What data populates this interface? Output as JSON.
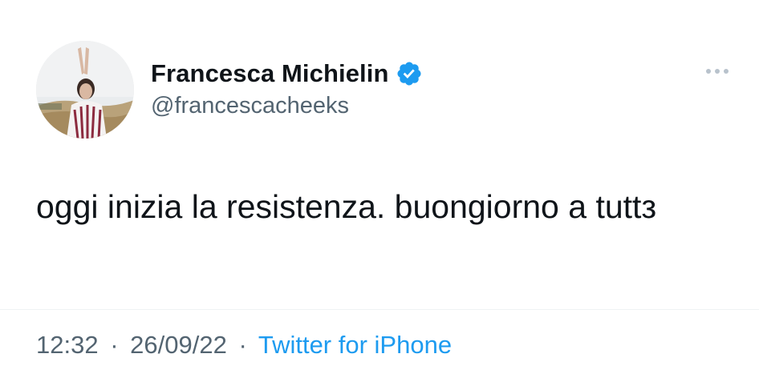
{
  "tweet": {
    "author": {
      "display_name": "Francesca Michielin",
      "handle": "@francescacheeks",
      "verified": true,
      "avatar_icon": "user-avatar-photo"
    },
    "more_icon": "ellipsis-icon",
    "text": "oggi inizia la resistenza. buongiorno a tuttз",
    "time": "12:32",
    "date": "26/09/22",
    "separator": "·",
    "source": "Twitter for iPhone"
  },
  "colors": {
    "text_primary": "#0f1419",
    "text_secondary": "#536471",
    "link_blue": "#1d9bf0",
    "verified_blue": "#1d9bf0"
  }
}
